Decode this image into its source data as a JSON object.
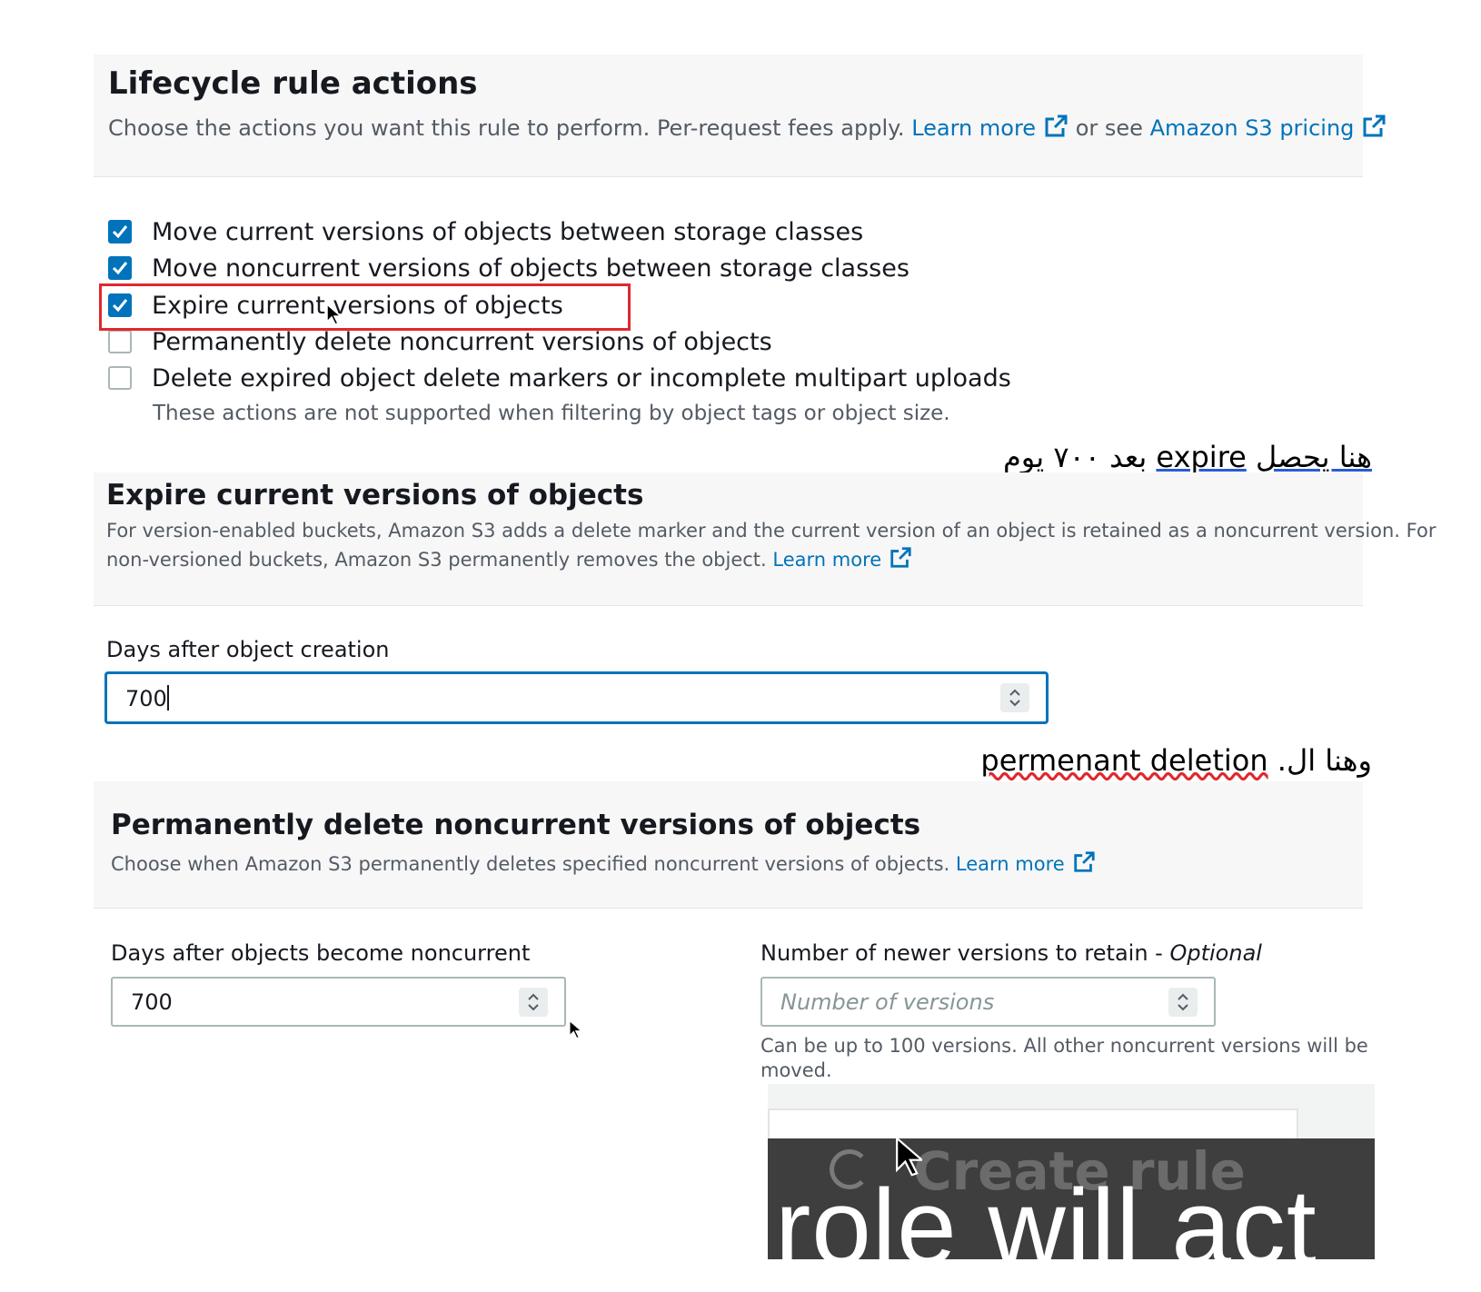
{
  "lifecycle": {
    "title": "Lifecycle rule actions",
    "desc_prefix": "Choose the actions you want this rule to perform. Per-request fees apply.",
    "learn_more": "Learn more",
    "or_see": "or see",
    "pricing_link": "Amazon S3 pricing",
    "options": [
      {
        "label": "Move current versions of objects between storage classes",
        "checked": true
      },
      {
        "label": "Move noncurrent versions of objects between storage classes",
        "checked": true
      },
      {
        "label": "Expire current versions of objects",
        "checked": true,
        "highlighted": true
      },
      {
        "label": "Permanently delete noncurrent versions of objects",
        "checked": false
      },
      {
        "label": "Delete expired object delete markers or incomplete multipart uploads",
        "checked": false
      }
    ],
    "note": "These actions are not supported when filtering by object tags or object size."
  },
  "annotation1": {
    "arabic_start": "هنا يحصل",
    "english": "expire",
    "arabic_end": "بعد ٧٠٠ يوم"
  },
  "expire": {
    "title": "Expire current versions of objects",
    "desc_line1": "For version-enabled buckets, Amazon S3 adds a delete marker and the current version of an object is retained as a noncurrent version. For",
    "desc_line2": "non-versioned buckets, Amazon S3 permanently removes the object.",
    "learn_more": "Learn more",
    "field_label": "Days after object creation",
    "field_value": "700"
  },
  "annotation2": {
    "arabic": "وهنا ال.",
    "english": "permenant deletion"
  },
  "permanent_delete": {
    "title": "Permanently delete noncurrent versions of objects",
    "desc": "Choose when Amazon S3 permanently deletes specified noncurrent versions of objects.",
    "learn_more": "Learn more",
    "days_label": "Days after objects become noncurrent",
    "days_value": "700",
    "versions_label": "Number of newer versions to retain -",
    "versions_optional": "Optional",
    "versions_placeholder": "Number of versions",
    "versions_hint_line1": "Can be up to 100 versions. All other noncurrent versions will be",
    "versions_hint_line2": "moved."
  },
  "overlay": {
    "button_label": "Create rule",
    "caption": "role will act"
  },
  "colors": {
    "accent": "#0073bb",
    "highlight_box": "#e0282e",
    "panel_bg": "#f7f7f7"
  }
}
